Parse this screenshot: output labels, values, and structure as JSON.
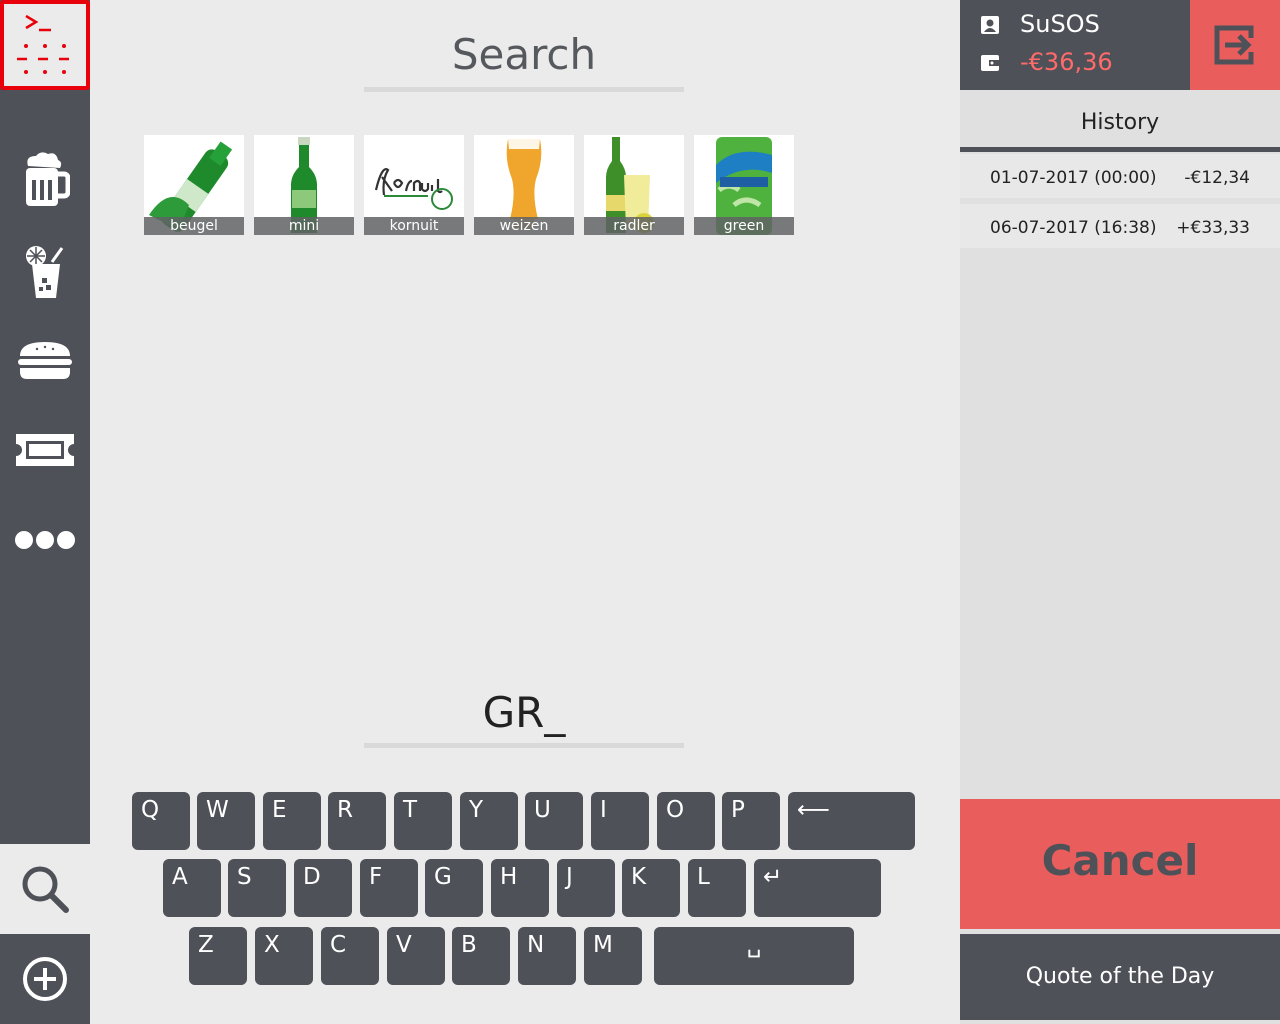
{
  "sidebar": {
    "logo_icon": "terminal-keypad-icon",
    "items": [
      {
        "name": "beer",
        "icon": "beer-mug-icon"
      },
      {
        "name": "soft-drinks",
        "icon": "soft-drink-icon"
      },
      {
        "name": "food",
        "icon": "burger-icon"
      },
      {
        "name": "tickets",
        "icon": "ticket-icon"
      },
      {
        "name": "more",
        "icon": "ellipsis-icon"
      },
      {
        "name": "search",
        "icon": "search-icon",
        "active": true
      },
      {
        "name": "add",
        "icon": "plus-circle-icon"
      }
    ]
  },
  "search": {
    "title": "Search",
    "query": "GR_",
    "results": [
      {
        "label": "beugel",
        "icon": "green-bottle-tilted-image"
      },
      {
        "label": "mini",
        "icon": "green-bottle-image"
      },
      {
        "label": "kornuit",
        "icon": "kornuit-logo-image"
      },
      {
        "label": "weizen",
        "icon": "wheat-beer-glass-image"
      },
      {
        "label": "radler",
        "icon": "radler-bottle-glass-image"
      },
      {
        "label": "green",
        "icon": "nestea-can-image"
      }
    ]
  },
  "keyboard": {
    "row1": [
      "Q",
      "W",
      "E",
      "R",
      "T",
      "Y",
      "U",
      "I",
      "O",
      "P"
    ],
    "row2": [
      "A",
      "S",
      "D",
      "F",
      "G",
      "H",
      "J",
      "K",
      "L"
    ],
    "row3": [
      "Z",
      "X",
      "C",
      "V",
      "B",
      "N",
      "M"
    ],
    "backspace": "⟵",
    "enter": "↵",
    "space": "␣"
  },
  "user": {
    "name": "SuSOS",
    "balance": "-€36,36",
    "balance_color": "#ff6a6a"
  },
  "history": {
    "title": "History",
    "rows": [
      {
        "date": "01-07-2017 (00:00)",
        "amount": "-€12,34"
      },
      {
        "date": "06-07-2017 (16:38)",
        "amount": "+€33,33"
      }
    ]
  },
  "actions": {
    "cancel": "Cancel",
    "quote": "Quote of the Day"
  },
  "colors": {
    "accent": "#e95d5d",
    "dark": "#4e5157",
    "logo_border": "#e8000b"
  }
}
